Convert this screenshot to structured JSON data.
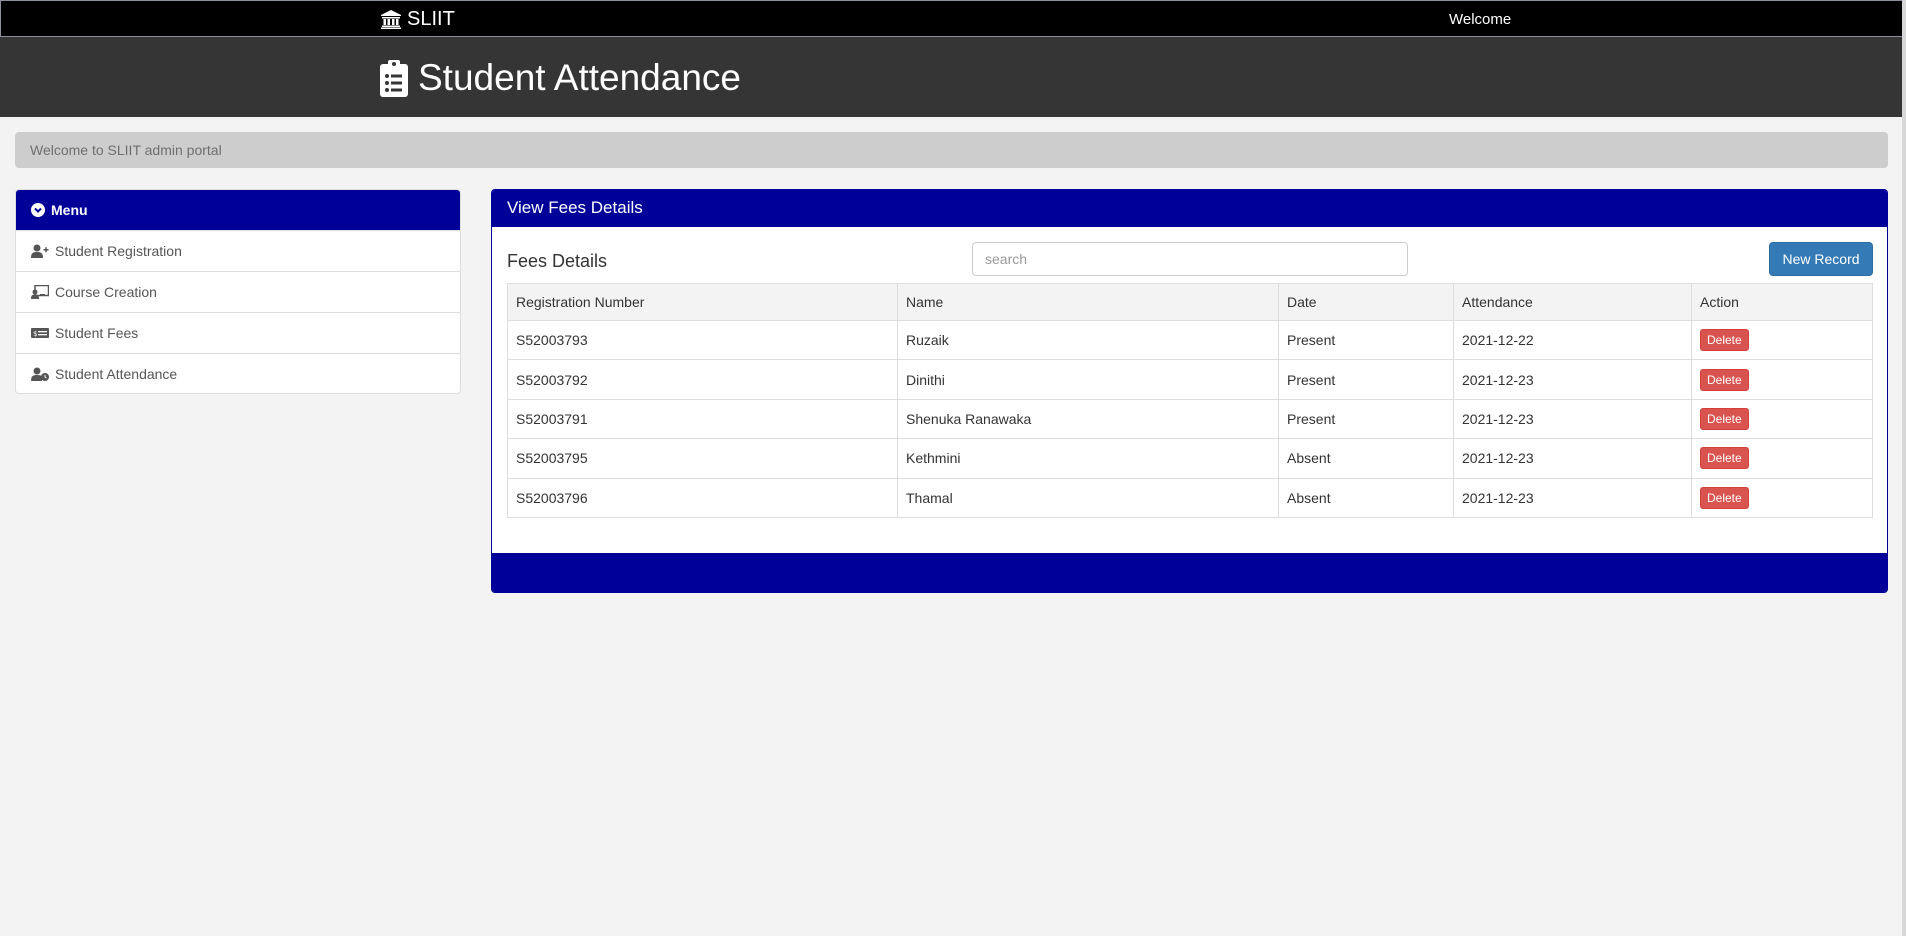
{
  "topbar": {
    "brand": "SLIIT",
    "welcome": "Welcome"
  },
  "header": {
    "title": "Student Attendance"
  },
  "welcome_bar": {
    "text": "Welcome to SLIIT admin portal"
  },
  "menu": {
    "title": "Menu",
    "items": [
      {
        "label": "Student Registration",
        "icon": "user-plus-icon"
      },
      {
        "label": "Course Creation",
        "icon": "chalkboard-teacher-icon"
      },
      {
        "label": "Student Fees",
        "icon": "money-bill-icon"
      },
      {
        "label": "Student Attendance",
        "icon": "user-clock-icon"
      }
    ]
  },
  "content": {
    "panel_title": "View Fees Details",
    "section_title": "Fees Details",
    "search_placeholder": "search",
    "new_record_label": "New Record",
    "columns": [
      "Registration Number",
      "Name",
      "Date",
      "Attendance",
      "Action"
    ],
    "rows": [
      {
        "reg": "S52003793",
        "name": "Ruzaik",
        "date": "Present",
        "attendance": "2021-12-22",
        "action": "Delete"
      },
      {
        "reg": "S52003792",
        "name": "Dinithi",
        "date": "Present",
        "attendance": "2021-12-23",
        "action": "Delete"
      },
      {
        "reg": "S52003791",
        "name": "Shenuka Ranawaka",
        "date": "Present",
        "attendance": "2021-12-23",
        "action": "Delete"
      },
      {
        "reg": "S52003795",
        "name": "Kethmini",
        "date": "Absent",
        "attendance": "2021-12-23",
        "action": "Delete"
      },
      {
        "reg": "S52003796",
        "name": "Thamal",
        "date": "Absent",
        "attendance": "2021-12-23",
        "action": "Delete"
      }
    ]
  },
  "colors": {
    "primary_blue": "#000099",
    "header_dark": "#353535",
    "topbar_black": "#000000",
    "delete_red": "#d9534f",
    "button_blue": "#337ab7"
  }
}
